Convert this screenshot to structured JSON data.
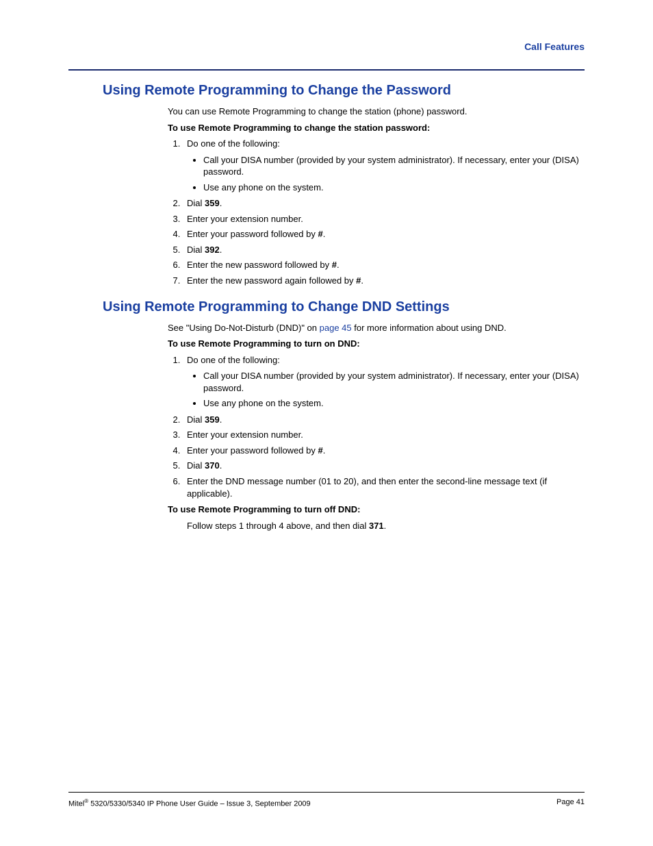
{
  "header": {
    "section": "Call Features"
  },
  "section1": {
    "title": "Using Remote Programming to Change the Password",
    "intro": "You can use Remote Programming to change the station (phone) password.",
    "sub": "To use Remote Programming to change the station password:",
    "step1": "Do one of the following:",
    "step1a": "Call your DISA number (provided by your system administrator). If necessary, enter your (DISA) password.",
    "step1b": "Use any phone on the system.",
    "step2_a": "Dial ",
    "step2_b": "359",
    "step2_c": ".",
    "step3": "Enter your extension number.",
    "step4_a": "Enter your password followed by ",
    "step4_b": "#",
    "step4_c": ".",
    "step5_a": "Dial ",
    "step5_b": "392",
    "step5_c": ".",
    "step6_a": "Enter the new password followed by ",
    "step6_b": "#",
    "step6_c": ".",
    "step7_a": "Enter the new password again followed by ",
    "step7_b": "#",
    "step7_c": "."
  },
  "section2": {
    "title": "Using Remote Programming to Change DND Settings",
    "intro_a": "See \"Using Do-Not-Disturb (DND)\" on ",
    "intro_link": "page 45",
    "intro_b": " for more information about using DND.",
    "sub1": "To use Remote Programming to turn on DND:",
    "step1": "Do one of the following:",
    "step1a": "Call your DISA number (provided by your system administrator). If necessary, enter your (DISA) password.",
    "step1b": "Use any phone on the system.",
    "step2_a": "Dial ",
    "step2_b": "359",
    "step2_c": ".",
    "step3": "Enter your extension number.",
    "step4_a": "Enter your password followed by ",
    "step4_b": "#",
    "step4_c": ".",
    "step5_a": "Dial ",
    "step5_b": "370",
    "step5_c": ".",
    "step6": "Enter the DND message number (01 to 20), and then enter the second-line message text (if applicable).",
    "sub2": "To use Remote Programming to turn off DND:",
    "off_a": "Follow steps 1 through 4 above, and then dial ",
    "off_b": "371",
    "off_c": "."
  },
  "footer": {
    "left_a": "Mitel",
    "left_b": " 5320/5330/5340 IP Phone User Guide  – Issue 3, September 2009",
    "right": "Page 41"
  }
}
